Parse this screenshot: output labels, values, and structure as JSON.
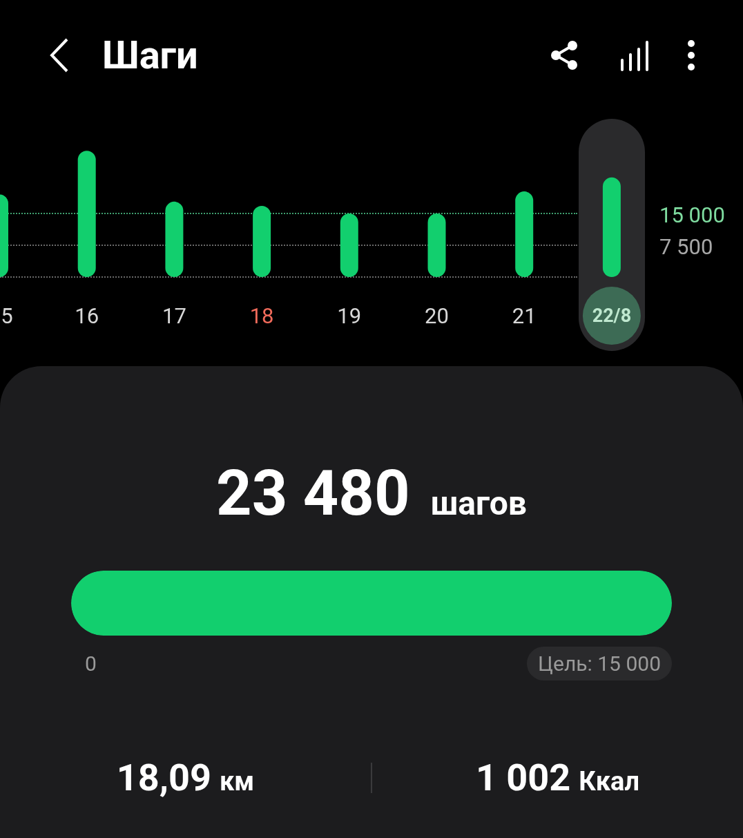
{
  "header": {
    "title": "Шаги"
  },
  "chart": {
    "day_states": [
      {
        "weekend": false,
        "selected": false
      },
      {
        "weekend": false,
        "selected": false
      },
      {
        "weekend": false,
        "selected": false
      },
      {
        "weekend": true,
        "selected": false
      },
      {
        "weekend": false,
        "selected": false
      },
      {
        "weekend": false,
        "selected": false
      },
      {
        "weekend": false,
        "selected": false
      },
      {
        "weekend": false,
        "selected": true
      }
    ],
    "chart_data": {
      "type": "bar",
      "categories": [
        "5",
        "16",
        "17",
        "18",
        "19",
        "20",
        "21",
        "22/8"
      ],
      "series": [
        {
          "color": "#12cf6e",
          "values": [
            19500,
            29800,
            17800,
            16800,
            15000,
            15000,
            20200,
            23500
          ]
        }
      ],
      "ylim": [
        0,
        30000
      ],
      "yticks": [
        {
          "value": 7500,
          "label": "7 500"
        },
        {
          "value": 15000,
          "label": "15 000"
        }
      ]
    }
  },
  "summary": {
    "steps": "23 480",
    "steps_unit": "шагов",
    "level": 1,
    "min_label": "0",
    "goal": "Цель: 15 000",
    "distance": "18,09",
    "distance_unit": "км",
    "calories": "1 002",
    "calories_unit": "Ккал"
  }
}
